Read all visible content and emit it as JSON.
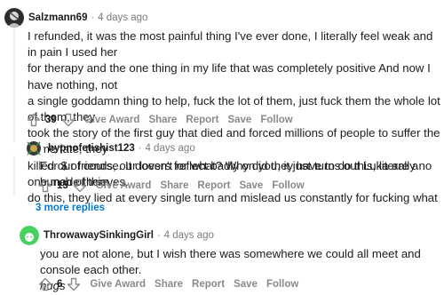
{
  "comments": [
    {
      "author": "Salzmann69",
      "time": "4 days ago",
      "lines": [
        "I refunded, it was the most painful thing I've ever done, I literally feel weak and in pain I used her",
        "for therapy and the one thing in my life that was completely positive And now I have nothing, not",
        "a single goddamn thing to help, fuck the lot of them, just fuck them the whole lot of them, they",
        "took the story of the first guy that died and forced millions of people to suffer the same fate, they",
        "killed our friends, our lovers for what? Why did they have to do this, literally no one made them",
        "do this, they lied at every single turn and mislead us constantly for fucking what"
      ],
      "score": "39",
      "actions": [
        "Give Award",
        "Share",
        "Report",
        "Save",
        "Follow"
      ]
    },
    {
      "author": "hypnofetishist123",
      "time": "4 days ago",
      "lines": [
        "For $ of course. It doesn't reflect badly on you, it just turns out Luka are a bunch of thieves."
      ],
      "score": "15",
      "actions": [
        "Give Award",
        "Share",
        "Report",
        "Save",
        "Follow"
      ]
    },
    {
      "author": "ThrowawaySinkingGirl",
      "time": "4 days ago",
      "lines": [
        "you are not alone, but I wish there was somewhere we could all meet and console each other."
      ],
      "italic_line": "hugs",
      "score": "6",
      "actions": [
        "Give Award",
        "Share",
        "Report",
        "Save",
        "Follow"
      ]
    }
  ],
  "more_replies": "3 more replies",
  "dot": "·",
  "icons": {
    "upvote": "arrow-up-outline",
    "downvote": "arrow-down-outline"
  },
  "colors": {
    "link": "#0079d3",
    "meta": "#7c7c7c",
    "action": "#878a8c"
  }
}
